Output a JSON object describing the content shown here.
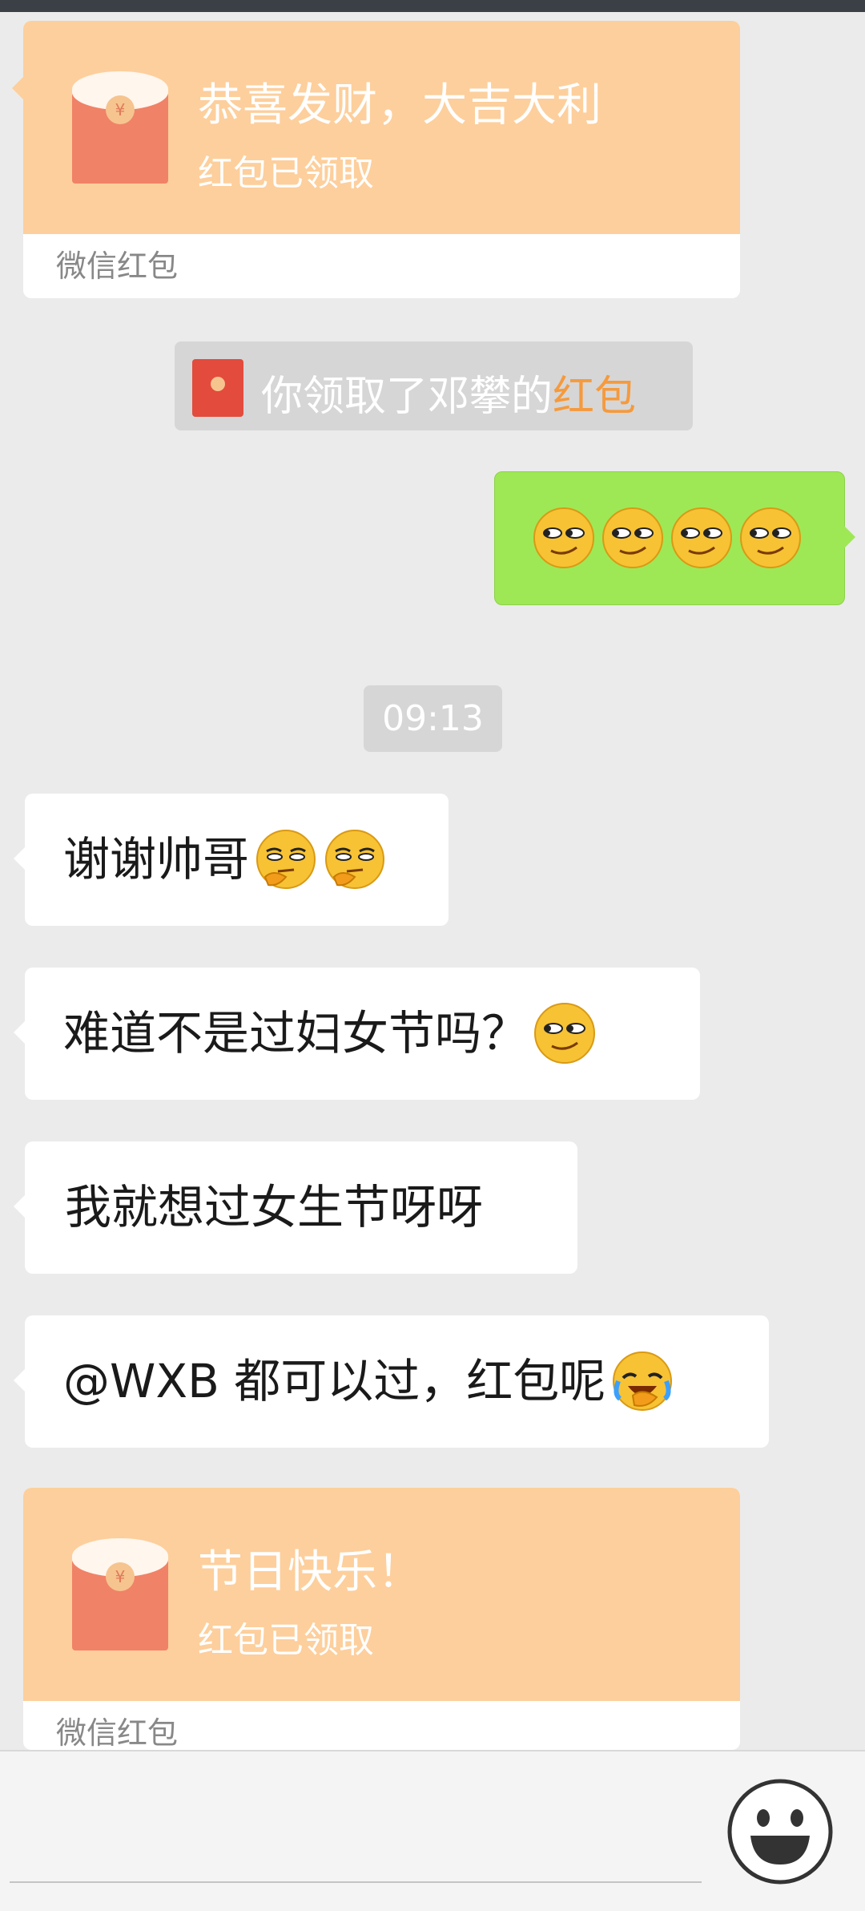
{
  "packet_1": {
    "greeting": "恭喜发财，大吉大利",
    "status": "红包已领取",
    "footer": "微信红包"
  },
  "system_notice": {
    "text": "你领取了邓攀的",
    "link": "红包"
  },
  "sent_message": {
    "emojis": [
      "smirk-emoji",
      "smirk-emoji",
      "smirk-emoji",
      "smirk-emoji"
    ]
  },
  "timestamp": "09:13",
  "messages": [
    {
      "text": "谢谢帅哥"
    },
    {
      "text": "难道不是过妇女节吗？"
    },
    {
      "text": "我就想过女生节呀呀"
    },
    {
      "text": "@WXB 都可以过，红包呢"
    }
  ],
  "packet_2": {
    "greeting": "节日快乐！",
    "status": "红包已领取",
    "footer": "微信红包"
  },
  "colors": {
    "packet_orange": "#fdcf9c",
    "sent_green": "#9ee855",
    "link_orange": "#f59a3d",
    "background": "#ebebeb"
  }
}
